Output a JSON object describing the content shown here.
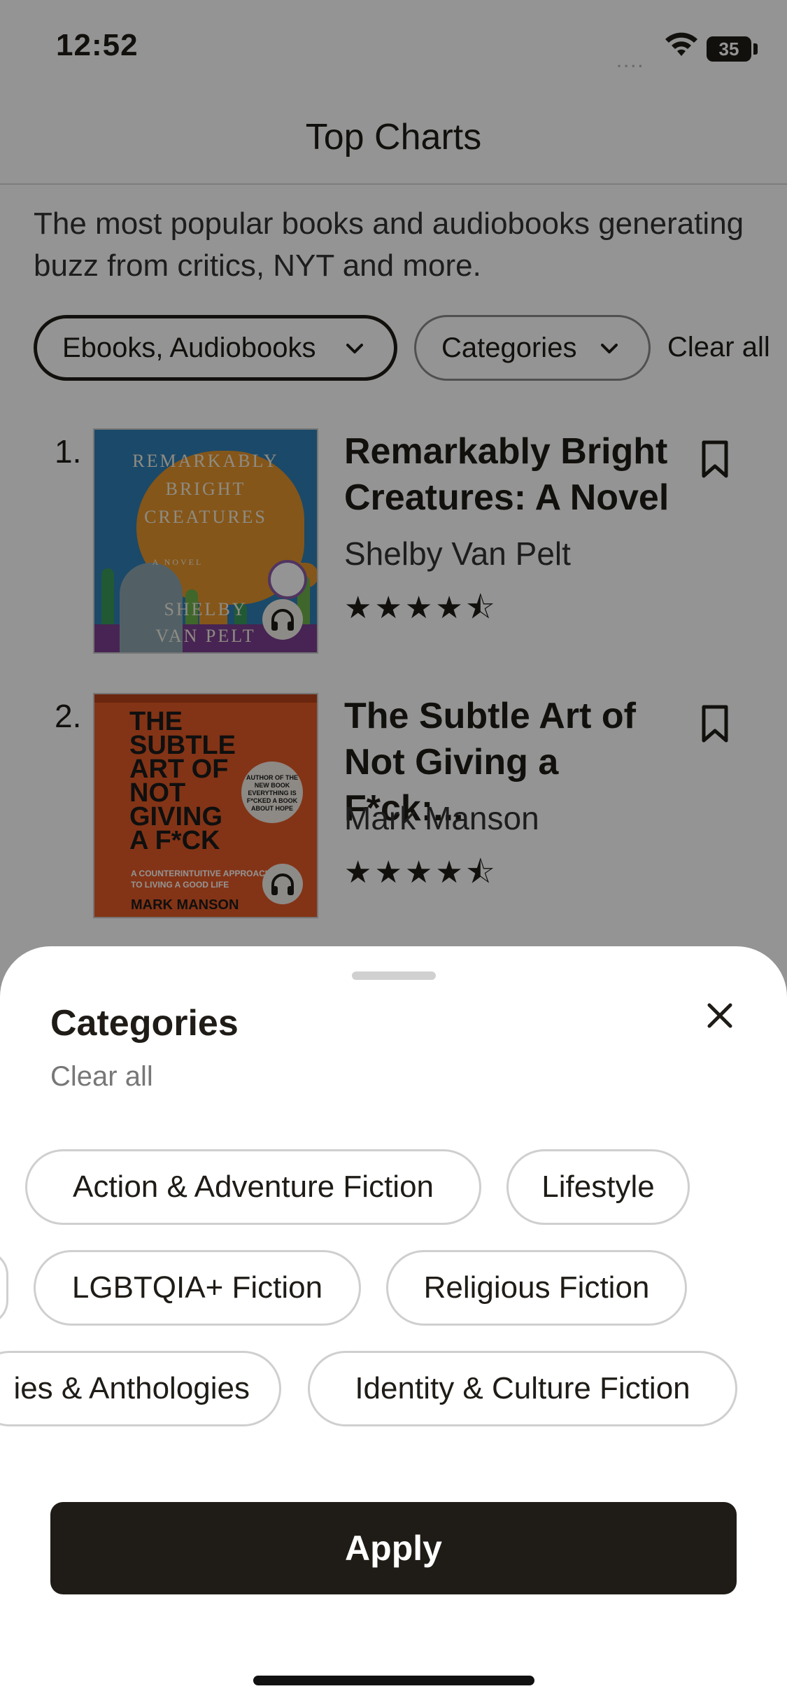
{
  "status_bar": {
    "time": "12:52",
    "signal": "....",
    "battery": "35"
  },
  "header": {
    "title": "Top Charts",
    "subtitle": "The most popular books and audiobooks generating buzz from critics, NYT and more."
  },
  "filters": {
    "formats_label": "Ebooks, Audiobooks",
    "categories_label": "Categories",
    "clear_all": "Clear all"
  },
  "books": [
    {
      "rank": "1.",
      "title": "Remarkably Bright Creatures: A Novel",
      "author": "Shelby Van Pelt",
      "rating": 4.5,
      "stars": "★★★★⯪",
      "cover": {
        "line1": "REMARKABLY",
        "line2": "BRIGHT",
        "line3": "CREATURES",
        "tag": "A NOVEL",
        "author1": "SHELBY",
        "author2": "VAN PELT"
      }
    },
    {
      "rank": "2.",
      "title": "The Subtle Art of Not Giving a F*ck:...",
      "author": "Mark Manson",
      "rating": 4.5,
      "stars": "★★★★⯪",
      "cover": {
        "title_lines": "THE\nSUBTLE\nART OF\nNOT\nGIVING\nA F*CK",
        "badge": "AUTHOR OF THE NEW BOOK EVERYTHING IS F*CKED A BOOK ABOUT HOPE",
        "tagline": "A COUNTERINTUITIVE APPROACH TO LIVING A GOOD LIFE",
        "author": "MARK MANSON"
      }
    }
  ],
  "sheet": {
    "title": "Categories",
    "clear_all": "Clear all",
    "rows": [
      [
        "Action & Adventure Fiction",
        "Lifestyle"
      ],
      [
        "LGBTQIA+ Fiction",
        "Religious Fiction"
      ],
      [
        "ies & Anthologies",
        "Identity & Culture Fiction"
      ]
    ],
    "apply_label": "Apply"
  },
  "icons": {
    "wifi": "wifi-icon",
    "battery": "battery-icon",
    "chevron": "chevron-down-icon",
    "bookmark": "bookmark-icon",
    "headphones": "headphones-icon",
    "close": "close-icon"
  },
  "colors": {
    "primary_dark": "#1f1b16",
    "overlay": "rgba(0,0,0,0.42)",
    "chip_border": "#cfcfcf"
  }
}
